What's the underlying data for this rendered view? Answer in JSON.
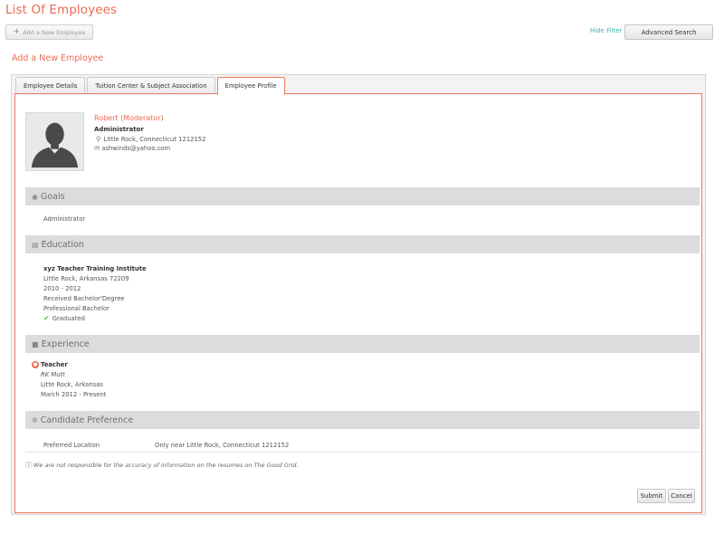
{
  "header": {
    "title": "List Of Employees",
    "add_button": "Add a New Employee",
    "hide_filter": "Hide Filter",
    "advanced_search": "Advanced Search"
  },
  "form": {
    "title": "Add a New Employee",
    "tabs": [
      {
        "label": "Employee Details",
        "active": false
      },
      {
        "label": "Tuition Center & Subject Association",
        "active": false
      },
      {
        "label": "Employee Profile",
        "active": true
      }
    ]
  },
  "profile": {
    "name": "Robert (Moderator)",
    "role": "Administrator",
    "location": "Little Rock, Connecticut  1212152",
    "email": "ashwinds@yahoo.com"
  },
  "goals": {
    "title": "Goals",
    "text": "Administrator"
  },
  "education": {
    "title": "Education",
    "institute": "xyz Teacher Training Institute",
    "location": "Little Rock, Arkansas  72209",
    "years": "2010 - 2012",
    "degree": "Received Bachelor'Degree",
    "type": "Professional Bachelor",
    "status": "Graduated"
  },
  "experience": {
    "title": "Experience",
    "position": "Teacher",
    "company": "RK Mutt",
    "location": "Litte Rock, Arkansas",
    "period": "March 2012 - Present"
  },
  "preference": {
    "title": "Candidate Preference",
    "label": "Preferred Location",
    "value": "Only near Little Rock, Connecticut 1212152"
  },
  "disclaimer": "We are not responsible for the accuracy of information on the resumes on The Good Grid.",
  "actions": {
    "submit": "Submit",
    "cancel": "Cancel"
  },
  "colors": {
    "accent": "#ee6a50",
    "link": "#3bb3a7",
    "section_bar": "#dcdcdc"
  }
}
